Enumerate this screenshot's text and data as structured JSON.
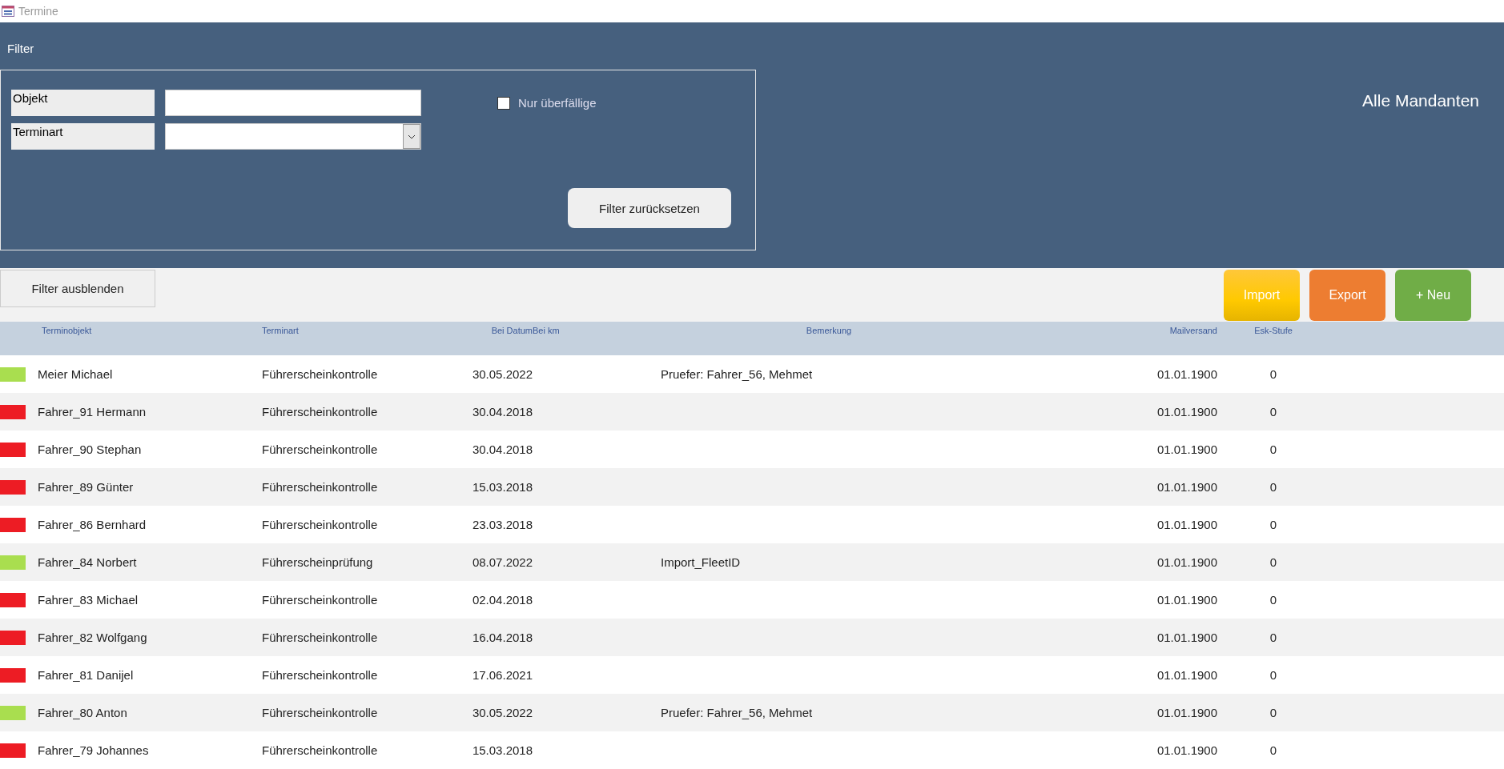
{
  "window": {
    "title": "Termine"
  },
  "filter": {
    "title": "Filter",
    "fields": [
      {
        "label": "Objekt",
        "kind": "text"
      },
      {
        "label": "Terminart",
        "kind": "dropdown"
      }
    ],
    "overdue": {
      "label": "Nur überfällige",
      "checked": false
    },
    "reset_button": "Filter zurücksetzen"
  },
  "client_label": "Alle Mandanten",
  "toolbar": {
    "hide_filter_button": "Filter ausblenden",
    "buttons": [
      {
        "label": "Import",
        "kind": "import"
      },
      {
        "label": "Export",
        "kind": "export"
      },
      {
        "label": "+ Neu",
        "kind": "new"
      }
    ]
  },
  "table": {
    "columns": [
      "Terminobjekt",
      "Terminart",
      "Bei Datum",
      "Bei km",
      "Bemerkung",
      "Mailversand",
      "Esk-Stufe"
    ],
    "rows": [
      {
        "color": "#a9de4f",
        "object": "Meier Michael",
        "type": "Führerscheinkontrolle",
        "date": "30.05.2022",
        "note": "Pruefer: Fahrer_56, Mehmet",
        "mail": "01.01.1900",
        "level": "0"
      },
      {
        "color": "#ed1c24",
        "object": "Fahrer_91 Hermann",
        "type": "Führerscheinkontrolle",
        "date": "30.04.2018",
        "mail": "01.01.1900",
        "level": "0"
      },
      {
        "color": "#ed1c24",
        "object": "Fahrer_90 Stephan",
        "type": "Führerscheinkontrolle",
        "date": "30.04.2018",
        "mail": "01.01.1900",
        "level": "0"
      },
      {
        "color": "#ed1c24",
        "object": "Fahrer_89 Günter",
        "type": "Führerscheinkontrolle",
        "date": "15.03.2018",
        "mail": "01.01.1900",
        "level": "0"
      },
      {
        "color": "#ed1c24",
        "object": "Fahrer_86 Bernhard",
        "type": "Führerscheinkontrolle",
        "date": "23.03.2018",
        "mail": "01.01.1900",
        "level": "0"
      },
      {
        "color": "#a9de4f",
        "object": "Fahrer_84 Norbert",
        "type": "Führerscheinprüfung",
        "date": "08.07.2022",
        "note": "Import_FleetID",
        "mail": "01.01.1900",
        "level": "0"
      },
      {
        "color": "#ed1c24",
        "object": "Fahrer_83 Michael",
        "type": "Führerscheinkontrolle",
        "date": "02.04.2018",
        "mail": "01.01.1900",
        "level": "0"
      },
      {
        "color": "#ed1c24",
        "object": "Fahrer_82 Wolfgang",
        "type": "Führerscheinkontrolle",
        "date": "16.04.2018",
        "mail": "01.01.1900",
        "level": "0"
      },
      {
        "color": "#ed1c24",
        "object": "Fahrer_81 Danijel",
        "type": "Führerscheinkontrolle",
        "date": "17.06.2021",
        "mail": "01.01.1900",
        "level": "0"
      },
      {
        "color": "#a9de4f",
        "object": "Fahrer_80 Anton",
        "type": "Führerscheinkontrolle",
        "date": "30.05.2022",
        "note": "Pruefer: Fahrer_56, Mehmet",
        "mail": "01.01.1900",
        "level": "0"
      },
      {
        "color": "#ed1c24",
        "object": "Fahrer_79 Johannes",
        "type": "Führerscheinkontrolle",
        "date": "15.03.2018",
        "mail": "01.01.1900",
        "level": "0"
      }
    ]
  }
}
